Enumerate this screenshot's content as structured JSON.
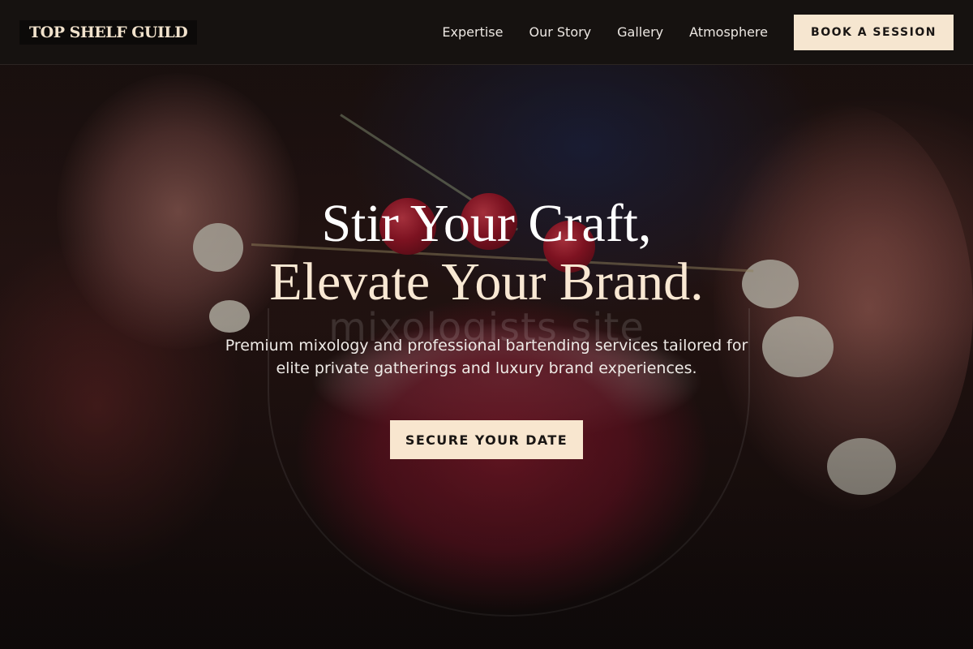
{
  "brand": {
    "logo_text": "TOP SHELF GUILD"
  },
  "nav": {
    "links": [
      "Expertise",
      "Our Story",
      "Gallery",
      "Atmosphere"
    ],
    "cta_label": "BOOK A SESSION"
  },
  "hero": {
    "title_line1": "Stir Your Craft,",
    "title_line2": "Elevate Your Brand.",
    "watermark": "mixologists site",
    "subtitle": "Premium mixology and professional bartending services tailored for elite private gatherings and luxury brand experiences.",
    "cta_label": "SECURE YOUR DATE"
  },
  "colors": {
    "accent": "#f6e6d0",
    "nav_bg": "#161210",
    "text_light": "#eeeae6"
  }
}
